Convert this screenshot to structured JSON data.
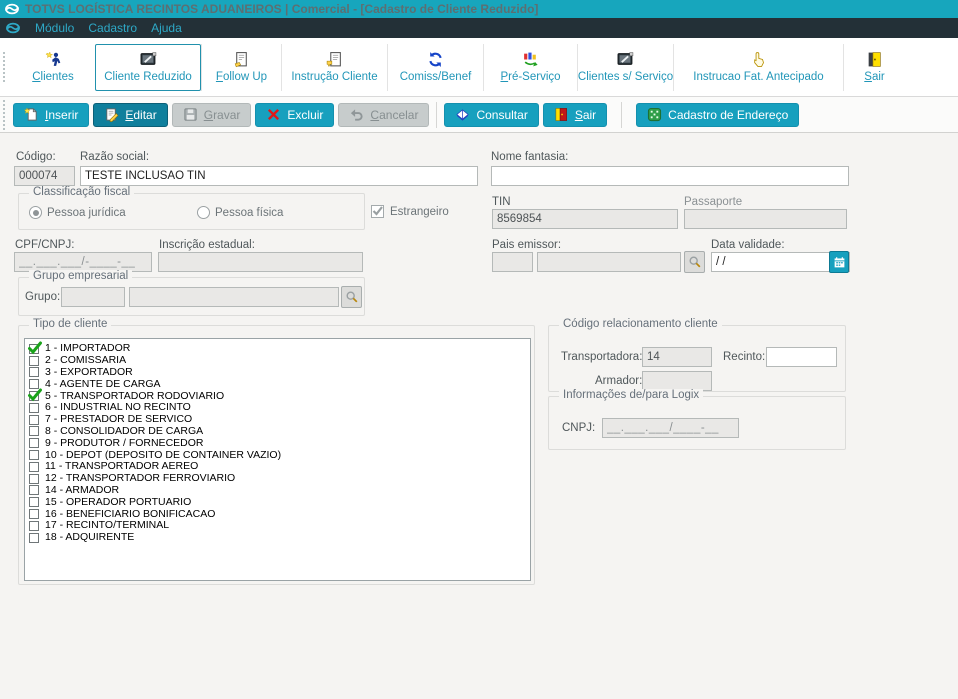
{
  "window": {
    "title": "TOTVS LOGÍSTICA RECINTOS ADUANEIROS | Comercial - [Cadastro de Cliente Reduzido]",
    "menu": [
      "Módulo",
      "Cadastro",
      "Ajuda"
    ]
  },
  "tabs": [
    {
      "label": "Clientes",
      "icon": "running-person-icon",
      "active": false
    },
    {
      "label": "Cliente Reduzido",
      "icon": "monitor-pen-icon",
      "active": true
    },
    {
      "label": "Follow Up",
      "icon": "document-note-icon",
      "active": false
    },
    {
      "label": "Instrução Cliente",
      "icon": "document-hand-icon",
      "active": false
    },
    {
      "label": "Comiss/Benef",
      "icon": "refresh-arrows-icon",
      "active": false
    },
    {
      "label": "Pré-Serviço",
      "icon": "chart-arrow-icon",
      "active": false
    },
    {
      "label": "Clientes s/ Serviço",
      "icon": "monitor-pen-icon",
      "active": false
    },
    {
      "label": "Instrucao Fat. Antecipado",
      "icon": "pointing-hand-icon",
      "active": false
    },
    {
      "label": "Sair",
      "icon": "exit-door-icon",
      "active": false
    }
  ],
  "toolbar": [
    {
      "label": "Inserir",
      "icon": "new-page-icon",
      "state": "enabled"
    },
    {
      "label": "Editar",
      "icon": "edit-doc-icon",
      "state": "pressed"
    },
    {
      "label": "Gravar",
      "icon": "save-floppy-icon",
      "state": "disabled"
    },
    {
      "label": "Excluir",
      "icon": "red-x-icon",
      "state": "enabled"
    },
    {
      "label": "Cancelar",
      "icon": "undo-arrow-icon",
      "state": "disabled"
    },
    {
      "label": "Consultar",
      "icon": "book-icon",
      "state": "enabled"
    },
    {
      "label": "Sair",
      "icon": "exit-door-icon",
      "state": "enabled"
    },
    {
      "label": "Cadastro de Endereço",
      "icon": "address-grid-icon",
      "state": "enabled"
    }
  ],
  "form": {
    "codigo": {
      "label": "Código:",
      "value": "000074"
    },
    "razao_social": {
      "label": "Razão social:",
      "value": "TESTE INCLUSAO TIN"
    },
    "nome_fantasia": {
      "label": "Nome fantasia:",
      "value": ""
    },
    "classificacao_fiscal": {
      "legend": "Classificação fiscal",
      "pessoa_juridica": {
        "label": "Pessoa jurídica",
        "selected": true
      },
      "pessoa_fisica": {
        "label": "Pessoa física",
        "selected": false
      }
    },
    "estrangeiro": {
      "label": "Estrangeiro",
      "checked": true
    },
    "tin": {
      "label": "TIN",
      "value": "8569854"
    },
    "passaporte": {
      "label": "Passaporte",
      "value": ""
    },
    "cpf_cnpj": {
      "label": "CPF/CNPJ:",
      "value": "__.___.___/-____-__"
    },
    "inscricao_estadual": {
      "label": "Inscrição estadual:",
      "value": ""
    },
    "pais_emissor": {
      "label": "Pais emissor:",
      "codigo": "",
      "nome": ""
    },
    "data_validade": {
      "label": "Data validade:",
      "value": "/ /"
    },
    "grupo_empresarial": {
      "legend": "Grupo empresarial",
      "label": "Grupo:",
      "codigo": "",
      "nome": ""
    },
    "tipo_cliente": {
      "legend": "Tipo de cliente",
      "items": [
        {
          "label": "1 - IMPORTADOR",
          "checked": true
        },
        {
          "label": "2 - COMISSARIA",
          "checked": false
        },
        {
          "label": "3 - EXPORTADOR",
          "checked": false
        },
        {
          "label": "4 - AGENTE DE CARGA",
          "checked": false
        },
        {
          "label": "5 - TRANSPORTADOR RODOVIARIO",
          "checked": true
        },
        {
          "label": "6 - INDUSTRIAL NO RECINTO",
          "checked": false
        },
        {
          "label": "7 - PRESTADOR DE SERVICO",
          "checked": false
        },
        {
          "label": "8 - CONSOLIDADOR DE CARGA",
          "checked": false
        },
        {
          "label": "9 - PRODUTOR / FORNECEDOR",
          "checked": false
        },
        {
          "label": "10 - DEPOT (DEPOSITO DE CONTAINER VAZIO)",
          "checked": false
        },
        {
          "label": "11 - TRANSPORTADOR AEREO",
          "checked": false
        },
        {
          "label": "12 - TRANSPORTADOR FERROVIARIO",
          "checked": false
        },
        {
          "label": "14 - ARMADOR",
          "checked": false
        },
        {
          "label": "15 - OPERADOR PORTUARIO",
          "checked": false
        },
        {
          "label": "16 - BENEFICIARIO BONIFICACAO",
          "checked": false
        },
        {
          "label": "17 - RECINTO/TERMINAL",
          "checked": false
        },
        {
          "label": "18 - ADQUIRENTE",
          "checked": false
        }
      ]
    },
    "relacionamento": {
      "legend": "Código relacionamento cliente",
      "transportadora": {
        "label": "Transportadora:",
        "value": "14"
      },
      "recinto": {
        "label": "Recinto:",
        "value": ""
      },
      "armador": {
        "label": "Armador:",
        "value": ""
      }
    },
    "logix": {
      "legend": "Informações de/para Logix",
      "cnpj": {
        "label": "CNPJ:",
        "value": "__.___.___/____-__"
      }
    }
  },
  "colors": {
    "titlebar": "#17a6bd",
    "menubar": "#233037",
    "accent": "#17a0be",
    "accent_pressed": "#0f7f9c",
    "disabled_button": "#c7cccc",
    "check_green": "#1aa31a"
  }
}
